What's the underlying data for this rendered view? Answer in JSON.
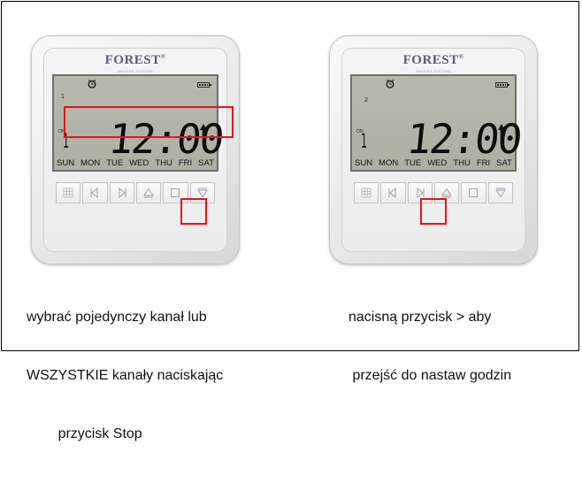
{
  "colors": {
    "highlight": "#e4141e",
    "lcd": "#b3b4a8",
    "device": "#ececec"
  },
  "panels": [
    {
      "logo": "FOREST",
      "logo_mark": "®",
      "logo_sub": "SHADING SYSTEMS",
      "channel_number": "1",
      "on_label": "ON",
      "small_digit": "1",
      "time": "12:00",
      "days": [
        "SUN",
        "MON",
        "TUE",
        "WED",
        "THU",
        "FRI",
        "SAT"
      ],
      "highlight_target": "channel display and stop button",
      "caption_lines": [
        "wybrać pojedynczy kanał lub",
        "WSZYSTKIE kanały naciskając",
        "        przycisk Stop"
      ]
    },
    {
      "logo": "FOREST",
      "logo_mark": "®",
      "logo_sub": "SHADING SYSTEMS",
      "channel_number": "2",
      "on_label": "ON",
      "small_digit": "1",
      "time": "12:00",
      "days": [
        "SUN",
        "MON",
        "TUE",
        "WED",
        "THU",
        "FRI",
        "SAT"
      ],
      "highlight_target": "right (next) button",
      "caption_lines": [
        "nacisną przycisk > aby",
        " przejść do nastaw godzin"
      ]
    }
  ],
  "buttons": [
    "grid-icon",
    "left-triangle-icon",
    "right-triangle-icon",
    "up-triangle-icon",
    "stop-square-icon",
    "down-triangle-icon"
  ]
}
